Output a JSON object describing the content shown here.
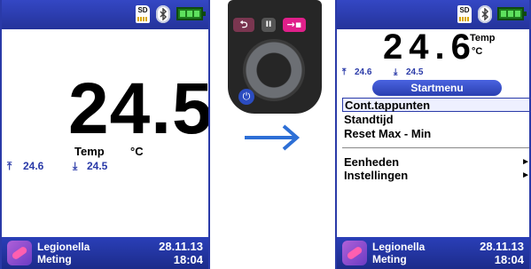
{
  "left_screen": {
    "status": {
      "sd_label": "SD",
      "icons": [
        "sd-card-icon",
        "bluetooth-icon",
        "battery-icon"
      ]
    },
    "reading": {
      "value": "24.5",
      "label": "Temp",
      "unit": "°C"
    },
    "max": {
      "icon": "arrow-up-max-icon",
      "symbol": "⤒",
      "value": "24.6"
    },
    "min": {
      "icon": "arrow-down-min-icon",
      "symbol": "⤓",
      "value": "24.5"
    },
    "footer": {
      "app_line1": "Legionella",
      "app_line2": "Meting",
      "date": "28.11.13",
      "time": "18:04"
    }
  },
  "device": {
    "buttons": [
      {
        "name": "back",
        "icon": "back-arrow-icon",
        "glyph": "⮌",
        "color": "#7a3650"
      },
      {
        "name": "pause",
        "icon": "pause-icon",
        "glyph": "II",
        "color": "#555555"
      },
      {
        "name": "enter",
        "icon": "enter-icon",
        "glyph": "→▪",
        "color": "#e0208a"
      }
    ],
    "power_icon": "power-icon",
    "power_glyph": "⏻"
  },
  "transition_arrow": {
    "icon": "right-arrow-icon",
    "color": "#2d6fd6"
  },
  "right_screen": {
    "status": {
      "sd_label": "SD",
      "icons": [
        "sd-card-icon",
        "bluetooth-icon",
        "battery-icon"
      ]
    },
    "reading": {
      "value": "24.6",
      "label": "Temp",
      "unit": "°C"
    },
    "max": {
      "symbol": "⤒",
      "value": "24.6"
    },
    "min": {
      "symbol": "⤓",
      "value": "24.5"
    },
    "menu": {
      "title": "Startmenu",
      "items": [
        {
          "label": "Cont.tappunten",
          "selected": true
        },
        {
          "label": "Standtijd"
        },
        {
          "label": "Reset Max - Min"
        },
        {
          "label": "Eenheden",
          "submenu": "►"
        },
        {
          "label": "Instellingen",
          "submenu": "►"
        }
      ]
    },
    "footer": {
      "app_line1": "Legionella",
      "app_line2": "Meting",
      "date": "28.11.13",
      "time": "18:04"
    }
  },
  "colors": {
    "bar_blue": "#2a3aa8",
    "accent_blue": "#2d6fd6",
    "battery_green": "#1d7a1d"
  }
}
